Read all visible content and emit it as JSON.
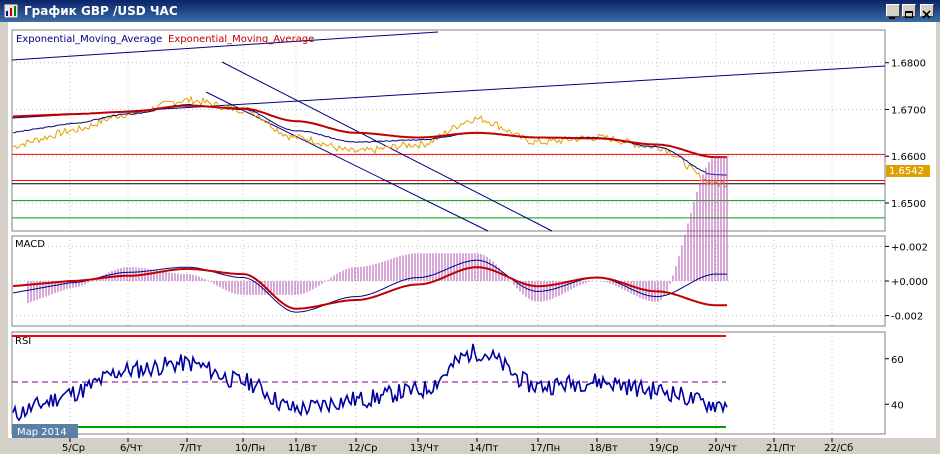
{
  "window": {
    "title": "График GBP /USD ЧАС",
    "buttons": [
      "minimize",
      "restore",
      "close"
    ]
  },
  "main_panel": {
    "legend_ema1": "Exponential_Moving_Average",
    "legend_ema2": "Exponential_Moving_Average",
    "price_labels": [
      "1.6800",
      "1.6700",
      "1.6600",
      "1.6500"
    ],
    "current_price": "1.6542",
    "horizontal_levels": [
      {
        "price": 1.6604,
        "color": "#ff0000"
      },
      {
        "price": 1.6548,
        "color": "#ff0000"
      },
      {
        "price": 1.6541,
        "color": "#000000"
      },
      {
        "price": 1.6505,
        "color": "#00a000"
      },
      {
        "price": 1.6468,
        "color": "#00a000"
      }
    ]
  },
  "macd_panel": {
    "label": "MACD",
    "scale_labels": [
      "+0.002",
      "+0.000",
      "-0.002"
    ]
  },
  "rsi_panel": {
    "label": "RSI",
    "scale_labels": [
      "60",
      "40"
    ]
  },
  "time_axis": {
    "month_label": "Мар 2014",
    "labels": [
      "5/Ср",
      "6/Чт",
      "7/Пт",
      "10/Пн",
      "11/Вт",
      "12/Ср",
      "13/Чт",
      "14/Пт",
      "17/Пн",
      "18/Вт",
      "19/Ср",
      "20/Чт",
      "21/Пт",
      "22/Сб"
    ]
  },
  "colors": {
    "price": "#e0a000",
    "ema_fast": "#000080",
    "ema_slow": "#c00000",
    "macd_hist": "#b050b0",
    "rsi": "#0000a0",
    "rsi_mid": "#800080",
    "rsi_top": "#ff0000",
    "rsi_bottom": "#00a000",
    "current_price_bg": "#e0a000"
  },
  "chart_data": {
    "type": "line",
    "x": [
      "5/Ср",
      "6/Чт",
      "7/Пт",
      "10/Пн",
      "11/Вт",
      "12/Ср",
      "13/Чт",
      "14/Пт",
      "17/Пн",
      "18/Вт",
      "19/Ср",
      "20/Чт"
    ],
    "series": [
      {
        "values": [
          1.6655,
          1.669,
          1.672,
          1.67,
          1.664,
          1.661,
          1.6625,
          1.668,
          1.663,
          1.664,
          1.662,
          1.6542
        ]
      },
      {
        "name": "Exponential_Moving_Average",
        "values": [
          1.667,
          1.669,
          1.671,
          1.67,
          1.6655,
          1.663,
          1.6635,
          1.665,
          1.664,
          1.664,
          1.662,
          1.656
        ]
      },
      {
        "name": "Exponential_Moving_Average",
        "values": [
          1.669,
          1.6695,
          1.6708,
          1.6702,
          1.6675,
          1.665,
          1.664,
          1.665,
          1.664,
          1.6638,
          1.6625,
          1.6598
        ]
      }
    ],
    "ylim": [
      1.644,
      1.687
    ]
  }
}
